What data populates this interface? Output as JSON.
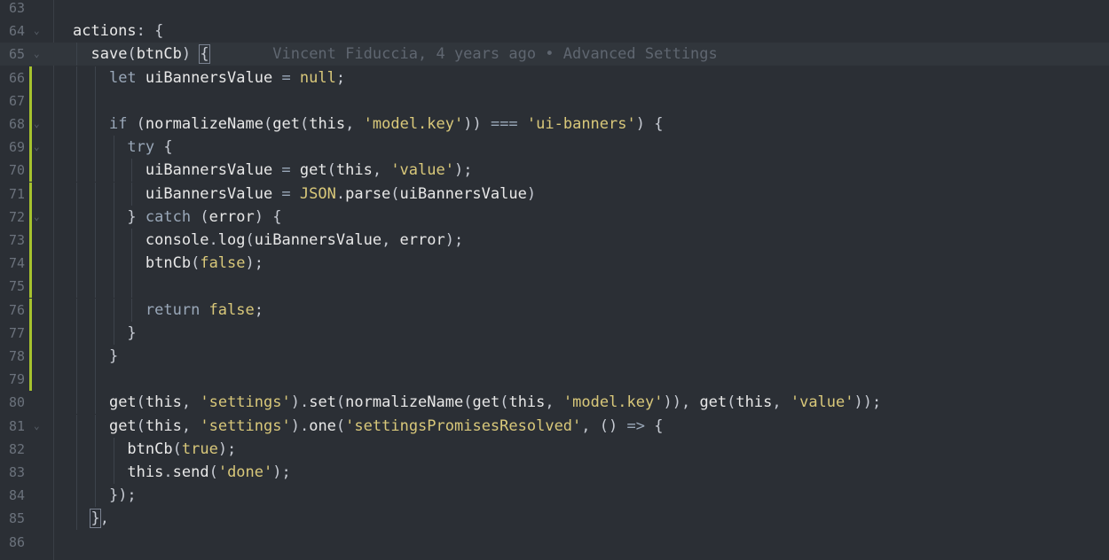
{
  "editor": {
    "blame": "Vincent Fiduccia, 4 years ago • Advanced Settings",
    "lines": [
      {
        "n": "63",
        "fold": "",
        "git": false,
        "indent": 0,
        "tokens": []
      },
      {
        "n": "64",
        "fold": "⌄",
        "git": false,
        "indent": 0,
        "tokens": [
          [
            "v",
            "actions"
          ],
          [
            "p",
            ": {"
          ]
        ]
      },
      {
        "n": "65",
        "fold": "⌄",
        "git": false,
        "indent": 1,
        "tokens": [
          [
            "fn",
            "save"
          ],
          [
            "p",
            "("
          ],
          [
            "v",
            "btnCb"
          ],
          [
            "p",
            ") "
          ],
          [
            "hl",
            "{"
          ]
        ]
      },
      {
        "n": "66",
        "fold": "",
        "git": true,
        "indent": 2,
        "tokens": [
          [
            "k",
            "let "
          ],
          [
            "v",
            "uiBannersValue "
          ],
          [
            "op",
            "= "
          ],
          [
            "lit",
            "null"
          ],
          [
            "p",
            ";"
          ]
        ]
      },
      {
        "n": "67",
        "fold": "",
        "git": true,
        "indent": 2,
        "tokens": []
      },
      {
        "n": "68",
        "fold": "⌄",
        "git": true,
        "indent": 2,
        "tokens": [
          [
            "k",
            "if "
          ],
          [
            "p",
            "("
          ],
          [
            "fn",
            "normalizeName"
          ],
          [
            "p",
            "("
          ],
          [
            "fn",
            "get"
          ],
          [
            "p",
            "("
          ],
          [
            "v",
            "this"
          ],
          [
            "p",
            ", "
          ],
          [
            "s",
            "'model.key'"
          ],
          [
            "p",
            "))"
          ],
          [
            "op",
            " === "
          ],
          [
            "s",
            "'ui-banners'"
          ],
          [
            "p",
            ") {"
          ]
        ]
      },
      {
        "n": "69",
        "fold": "⌄",
        "git": true,
        "indent": 3,
        "tokens": [
          [
            "k",
            "try "
          ],
          [
            "p",
            "{"
          ]
        ]
      },
      {
        "n": "70",
        "fold": "",
        "git": true,
        "indent": 4,
        "tokens": [
          [
            "v",
            "uiBannersValue "
          ],
          [
            "op",
            "= "
          ],
          [
            "fn",
            "get"
          ],
          [
            "p",
            "("
          ],
          [
            "v",
            "this"
          ],
          [
            "p",
            ", "
          ],
          [
            "s",
            "'value'"
          ],
          [
            "p",
            ");"
          ]
        ]
      },
      {
        "n": "71",
        "fold": "",
        "git": true,
        "indent": 4,
        "tokens": [
          [
            "v",
            "uiBannersValue "
          ],
          [
            "op",
            "= "
          ],
          [
            "json",
            "JSON"
          ],
          [
            "p",
            "."
          ],
          [
            "fn",
            "parse"
          ],
          [
            "p",
            "("
          ],
          [
            "v",
            "uiBannersValue"
          ],
          [
            "p",
            ")"
          ]
        ]
      },
      {
        "n": "72",
        "fold": "⌄",
        "git": true,
        "indent": 3,
        "tokens": [
          [
            "p",
            "} "
          ],
          [
            "k",
            "catch "
          ],
          [
            "p",
            "("
          ],
          [
            "v",
            "error"
          ],
          [
            "p",
            ") {"
          ]
        ]
      },
      {
        "n": "73",
        "fold": "",
        "git": true,
        "indent": 4,
        "tokens": [
          [
            "v",
            "console"
          ],
          [
            "p",
            "."
          ],
          [
            "fn",
            "log"
          ],
          [
            "p",
            "("
          ],
          [
            "v",
            "uiBannersValue"
          ],
          [
            "p",
            ", "
          ],
          [
            "v",
            "error"
          ],
          [
            "p",
            ");"
          ]
        ]
      },
      {
        "n": "74",
        "fold": "",
        "git": true,
        "indent": 4,
        "tokens": [
          [
            "fn",
            "btnCb"
          ],
          [
            "p",
            "("
          ],
          [
            "lit",
            "false"
          ],
          [
            "p",
            ");"
          ]
        ]
      },
      {
        "n": "75",
        "fold": "",
        "git": true,
        "indent": 4,
        "tokens": []
      },
      {
        "n": "76",
        "fold": "",
        "git": true,
        "indent": 4,
        "tokens": [
          [
            "k",
            "return "
          ],
          [
            "lit",
            "false"
          ],
          [
            "p",
            ";"
          ]
        ]
      },
      {
        "n": "77",
        "fold": "",
        "git": true,
        "indent": 3,
        "tokens": [
          [
            "p",
            "}"
          ]
        ]
      },
      {
        "n": "78",
        "fold": "",
        "git": true,
        "indent": 2,
        "tokens": [
          [
            "p",
            "}"
          ]
        ]
      },
      {
        "n": "79",
        "fold": "",
        "git": true,
        "indent": 2,
        "tokens": []
      },
      {
        "n": "80",
        "fold": "",
        "git": false,
        "indent": 2,
        "tokens": [
          [
            "fn",
            "get"
          ],
          [
            "p",
            "("
          ],
          [
            "v",
            "this"
          ],
          [
            "p",
            ", "
          ],
          [
            "s",
            "'settings'"
          ],
          [
            "p",
            ")."
          ],
          [
            "fn",
            "set"
          ],
          [
            "p",
            "("
          ],
          [
            "fn",
            "normalizeName"
          ],
          [
            "p",
            "("
          ],
          [
            "fn",
            "get"
          ],
          [
            "p",
            "("
          ],
          [
            "v",
            "this"
          ],
          [
            "p",
            ", "
          ],
          [
            "s",
            "'model.key'"
          ],
          [
            "p",
            ")), "
          ],
          [
            "fn",
            "get"
          ],
          [
            "p",
            "("
          ],
          [
            "v",
            "this"
          ],
          [
            "p",
            ", "
          ],
          [
            "s",
            "'value'"
          ],
          [
            "p",
            "));"
          ]
        ]
      },
      {
        "n": "81",
        "fold": "⌄",
        "git": false,
        "indent": 2,
        "tokens": [
          [
            "fn",
            "get"
          ],
          [
            "p",
            "("
          ],
          [
            "v",
            "this"
          ],
          [
            "p",
            ", "
          ],
          [
            "s",
            "'settings'"
          ],
          [
            "p",
            ")."
          ],
          [
            "fn",
            "one"
          ],
          [
            "p",
            "("
          ],
          [
            "s",
            "'settingsPromisesResolved'"
          ],
          [
            "p",
            ", () "
          ],
          [
            "op",
            "=> "
          ],
          [
            "p",
            "{"
          ]
        ]
      },
      {
        "n": "82",
        "fold": "",
        "git": false,
        "indent": 3,
        "tokens": [
          [
            "fn",
            "btnCb"
          ],
          [
            "p",
            "("
          ],
          [
            "lit",
            "true"
          ],
          [
            "p",
            ");"
          ]
        ]
      },
      {
        "n": "83",
        "fold": "",
        "git": false,
        "indent": 3,
        "tokens": [
          [
            "v",
            "this"
          ],
          [
            "p",
            "."
          ],
          [
            "fn",
            "send"
          ],
          [
            "p",
            "("
          ],
          [
            "s",
            "'done'"
          ],
          [
            "p",
            ");"
          ]
        ]
      },
      {
        "n": "84",
        "fold": "",
        "git": false,
        "indent": 2,
        "tokens": [
          [
            "p",
            "});"
          ]
        ]
      },
      {
        "n": "85",
        "fold": "",
        "git": false,
        "indent": 1,
        "tokens": [
          [
            "hl",
            "}"
          ],
          [
            "p",
            ","
          ]
        ]
      },
      {
        "n": "86",
        "fold": "",
        "git": false,
        "indent": 0,
        "tokens": []
      }
    ]
  }
}
